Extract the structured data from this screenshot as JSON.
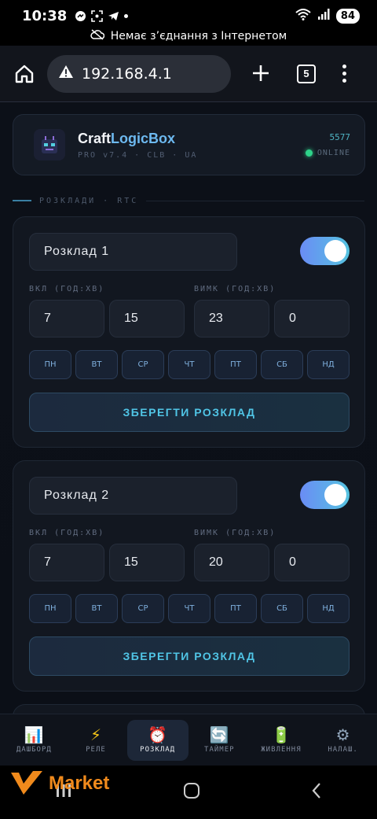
{
  "status_bar": {
    "time": "10:38",
    "battery": "84"
  },
  "offline_banner": "Немає з’єднання з Інтернетом",
  "browser": {
    "url": "192.168.4.1",
    "tab_count": "5"
  },
  "brand": {
    "name_part1": "Craft",
    "name_part2": "LogicBox",
    "subtitle": "PRO v7.4 · CLB · UA",
    "port": "5577",
    "status": "ONLINE"
  },
  "section": {
    "label": "РОЗКЛАДИ · RTC"
  },
  "schedules": [
    {
      "name": "Розклад 1",
      "enabled": true,
      "on_label": "ВКЛ (ГОД:ХВ)",
      "off_label": "ВИМК (ГОД:ХВ)",
      "on_hour": "7",
      "on_min": "15",
      "off_hour": "23",
      "off_min": "0",
      "days": [
        "ПН",
        "ВТ",
        "СР",
        "ЧТ",
        "ПТ",
        "СБ",
        "НД"
      ],
      "save_label": "ЗБЕРЕГТИ РОЗКЛАД"
    },
    {
      "name": "Розклад 2",
      "enabled": true,
      "on_label": "ВКЛ (ГОД:ХВ)",
      "off_label": "ВИМК (ГОД:ХВ)",
      "on_hour": "7",
      "on_min": "15",
      "off_hour": "20",
      "off_min": "0",
      "days": [
        "ПН",
        "ВТ",
        "СР",
        "ЧТ",
        "ПТ",
        "СБ",
        "НД"
      ],
      "save_label": "ЗБЕРЕГТИ РОЗКЛАД"
    }
  ],
  "bottom_nav": [
    {
      "label": "ДАШБОРД",
      "icon": "chart-icon",
      "glyph": "📊",
      "active": false
    },
    {
      "label": "РЕЛЕ",
      "icon": "lightning-icon",
      "glyph": "⚡",
      "active": false
    },
    {
      "label": "РОЗКЛАД",
      "icon": "alarm-clock-icon",
      "glyph": "⏰",
      "active": true
    },
    {
      "label": "ТАЙМЕР",
      "icon": "repeat-icon",
      "glyph": "🔄",
      "active": false
    },
    {
      "label": "ЖИВЛЕННЯ",
      "icon": "battery-icon",
      "glyph": "🔋",
      "active": false
    },
    {
      "label": "НАЛАШ.",
      "icon": "gear-icon",
      "glyph": "⚙",
      "active": false
    }
  ],
  "watermark": "Market",
  "colors": {
    "accent": "#50c5e6",
    "online": "#2ed38a",
    "watermark": "#f08a1c"
  }
}
